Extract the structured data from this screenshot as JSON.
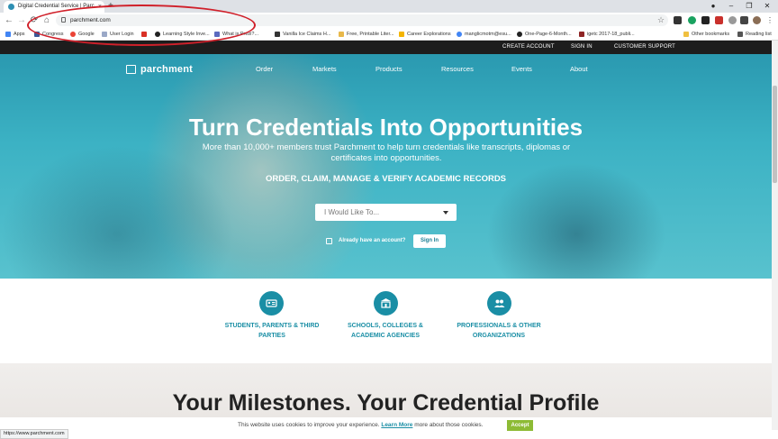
{
  "browser": {
    "tab_title": "Digital Credential Service | Parc...",
    "new_tab": "+",
    "close_tab": "×",
    "window_controls": [
      "●",
      "–",
      "❐",
      "✕"
    ],
    "url": "parchment.com",
    "back": "←",
    "forward": "→",
    "reload": "⟳",
    "home": "⌂",
    "star": "☆",
    "bookmarks": [
      "Apps",
      "Congress",
      "Google",
      "User Login",
      "",
      "Learning Style Inve...",
      "What is Prezi?...",
      "Vanilla Ice Claims H...",
      "Free, Printable Liter...",
      "Career Explorations",
      "manglicmotm@esu...",
      "One-Page-6-Month...",
      "igetc 2017-18_publi...",
      "Other bookmarks",
      "Reading list"
    ],
    "status_url": "https://www.parchment.com"
  },
  "site": {
    "top_links": [
      "CREATE ACCOUNT",
      "SIGN IN",
      "CUSTOMER SUPPORT"
    ],
    "logo": "parchment",
    "nav": [
      "Order",
      "Markets",
      "Products",
      "Resources",
      "Events",
      "About"
    ],
    "hero": {
      "title": "Turn Credentials Into Opportunities",
      "subtitle": "More than 10,000+ members trust Parchment to help turn credentials like transcripts, diplomas or certificates into opportunities.",
      "tagline": "ORDER, CLAIM, MANAGE & VERIFY ACADEMIC RECORDS",
      "select_placeholder": "I Would Like To...",
      "already": "Already have an account?",
      "signin": "Sign In"
    },
    "audiences": [
      {
        "label": "STUDENTS, PARENTS & THIRD PARTIES",
        "icon": "id-card-icon"
      },
      {
        "label": "SCHOOLS, COLLEGES & ACADEMIC AGENCIES",
        "icon": "school-building-icon"
      },
      {
        "label": "PROFESSIONALS & OTHER ORGANIZATIONS",
        "icon": "people-icon"
      }
    ],
    "milestone_title": "Your Milestones. Your Credential Profile",
    "cookie": {
      "text_before": "This website uses cookies to improve your experience.",
      "learn_more": "Learn More",
      "text_after": "more about those cookies.",
      "accept": "Accept"
    }
  },
  "colors": {
    "brand_teal": "#1a8ea5",
    "accept_green": "#8dbb35",
    "annotation_red": "#d0202a"
  }
}
